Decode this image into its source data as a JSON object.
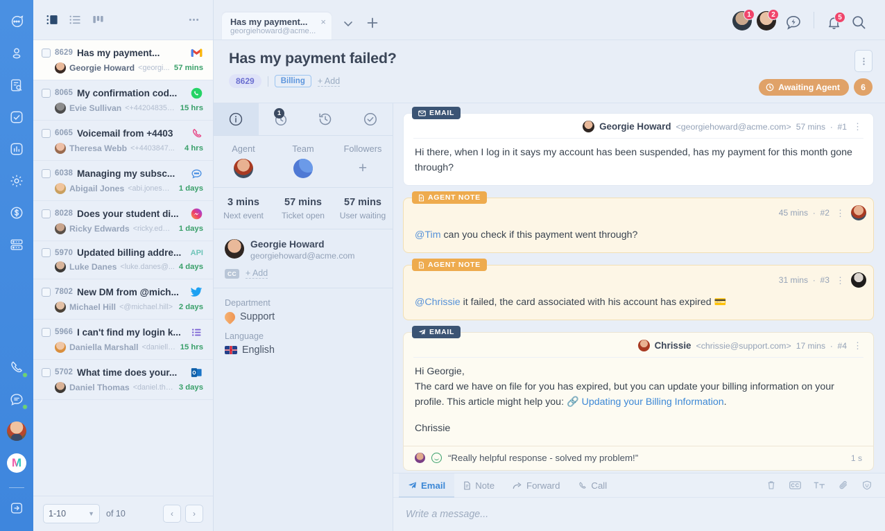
{
  "rail": {
    "items": [
      {
        "name": "chat",
        "icon": "chat-bubble-icon"
      },
      {
        "name": "contacts",
        "icon": "person-icon"
      },
      {
        "name": "search-docs",
        "icon": "document-search-icon"
      },
      {
        "name": "tasks",
        "icon": "check-square-icon"
      },
      {
        "name": "reports",
        "icon": "bar-chart-icon"
      },
      {
        "name": "settings",
        "icon": "gear-icon"
      },
      {
        "name": "billing",
        "icon": "dollar-circle-icon"
      },
      {
        "name": "servers",
        "icon": "server-icon"
      }
    ],
    "bottom": [
      {
        "name": "phone",
        "icon": "phone-icon",
        "status": "online"
      },
      {
        "name": "messages",
        "icon": "chat-lines-icon",
        "status": "online"
      },
      {
        "name": "profile",
        "icon": "avatar"
      },
      {
        "name": "brand",
        "icon": "logo",
        "logo_letter": "M"
      },
      {
        "name": "logout",
        "icon": "logout-arrow-icon"
      }
    ]
  },
  "list": {
    "toolbar": {
      "views": [
        "split-view-icon",
        "list-view-icon",
        "board-view-icon"
      ],
      "more": "more-dots-icon"
    },
    "tickets": [
      {
        "id": "8629",
        "subject": "Has my payment...",
        "author": "Georgie Howard",
        "email": "<georgi...",
        "time": "57 mins",
        "channel": "gmail",
        "selected": true
      },
      {
        "id": "8065",
        "subject": "My confirmation cod...",
        "author": "Evie Sullivan",
        "email": "<+442048356...",
        "time": "15 hrs",
        "channel": "whatsapp",
        "selected": false
      },
      {
        "id": "6065",
        "subject": "Voicemail from +4403",
        "author": "Theresa Webb",
        "email": "<+4403847...",
        "time": "4 hrs",
        "channel": "phone",
        "selected": false
      },
      {
        "id": "6038",
        "subject": "Managing my subsc...",
        "author": "Abigail Jones",
        "email": "<abi.jones@...",
        "time": "1 days",
        "channel": "chat",
        "selected": false
      },
      {
        "id": "8028",
        "subject": "Does your student di...",
        "author": "Ricky Edwards",
        "email": "<ricky.edwa...",
        "time": "1 days",
        "channel": "messenger",
        "selected": false
      },
      {
        "id": "5970",
        "subject": "Updated billing addre...",
        "author": "Luke Danes",
        "email": "<luke.danes@...",
        "time": "4 days",
        "channel": "api",
        "channel_label": "API",
        "selected": false
      },
      {
        "id": "7802",
        "subject": "New DM from @mich...",
        "author": "Michael Hill",
        "email": "<@michael.hill>",
        "time": "2 days",
        "channel": "twitter",
        "selected": false
      },
      {
        "id": "5966",
        "subject": "I can't find my login k...",
        "author": "Daniella Marshall",
        "email": "<daniella...",
        "time": "15 hrs",
        "channel": "form",
        "selected": false
      },
      {
        "id": "5702",
        "subject": "What time does your...",
        "author": "Daniel Thomas",
        "email": "<daniel.tho...",
        "time": "3 days",
        "channel": "outlook",
        "selected": false
      }
    ],
    "footer": {
      "range": "1-10",
      "of": "of 10",
      "prev": "‹",
      "next": "›"
    }
  },
  "topbar": {
    "tabs": [
      {
        "title": "Has my payment...",
        "subtitle": "georgiehoward@acme...",
        "close": "×"
      }
    ],
    "chevron": "chevron-down-icon",
    "plus": "plus-icon",
    "avatars": [
      {
        "badge": "1"
      },
      {
        "badge": "2"
      }
    ],
    "bolt_icon": "lightning-chat-icon",
    "bell_icon": "bell-icon",
    "bell_badge": "5",
    "search_icon": "search-icon"
  },
  "ticket": {
    "title": "Has my payment failed?",
    "id": "8629",
    "tag": "Billing",
    "add_tag": "+ Add",
    "status": "Awaiting Agent",
    "message_count": "6",
    "menu": "more-vertical-icon"
  },
  "info": {
    "tabs": [
      {
        "name": "details",
        "icon": "info-circle-icon",
        "active": true
      },
      {
        "name": "timer",
        "icon": "clock-icon",
        "badge": "1"
      },
      {
        "name": "history",
        "icon": "history-icon"
      },
      {
        "name": "resolved",
        "icon": "check-circle-icon"
      }
    ],
    "assign": [
      {
        "label": "Agent",
        "type": "avatar"
      },
      {
        "label": "Team",
        "type": "team"
      },
      {
        "label": "Followers",
        "type": "plus"
      }
    ],
    "stats": [
      {
        "value": "3 mins",
        "label": "Next event"
      },
      {
        "value": "57 mins",
        "label": "Ticket open"
      },
      {
        "value": "57 mins",
        "label": "User waiting"
      }
    ],
    "contact": {
      "name": "Georgie Howard",
      "email": "georgiehoward@acme.com",
      "cc_label": "CC",
      "cc_add": "+ Add"
    },
    "fields": [
      {
        "label": "Department",
        "value": "Support",
        "icon": "department-drop-icon"
      },
      {
        "label": "Language",
        "value": "English",
        "icon": "uk-flag-icon"
      }
    ]
  },
  "conversation": {
    "messages": [
      {
        "kind": "email",
        "direction": "in",
        "ribbon": "EMAIL",
        "ribbon_icon": "envelope-icon",
        "author": "Georgie Howard",
        "email": "<georgiehoward@acme.com>",
        "time": "57 mins",
        "num": "#1",
        "body": "Hi there, when I log in it says my account has been suspended, has my payment for this month gone through?"
      },
      {
        "kind": "note",
        "ribbon": "AGENT NOTE",
        "ribbon_icon": "note-icon",
        "time": "45 mins",
        "num": "#2",
        "mention": "@Tim",
        "body": " can you check if this payment went through?"
      },
      {
        "kind": "note",
        "ribbon": "AGENT NOTE",
        "ribbon_icon": "note-icon",
        "time": "31 mins",
        "num": "#3",
        "mention": "@Chrissie",
        "body": " it failed, the card associated with his account has expired 💳"
      },
      {
        "kind": "email",
        "direction": "out",
        "ribbon": "EMAIL",
        "ribbon_icon": "send-icon",
        "author": "Chrissie",
        "email": "<chrissie@support.com>",
        "time": "17 mins",
        "num": "#4",
        "line1": "Hi Georgie,",
        "line2": "The card we have on file for you has expired, but you can update your billing information on your profile. This article might help you: ",
        "link": "Updating your Billing Information",
        "line3": ".",
        "signoff": "Chrissie",
        "rating": "“Really helpful response - solved my problem!”",
        "rating_time": "1 s"
      }
    ]
  },
  "composer": {
    "tabs": [
      {
        "label": "Email",
        "icon": "send-icon",
        "active": true
      },
      {
        "label": "Note",
        "icon": "note-icon",
        "active": false
      },
      {
        "label": "Forward",
        "icon": "forward-arrow-icon",
        "active": false
      },
      {
        "label": "Call",
        "icon": "phone-icon",
        "active": false
      }
    ],
    "tools": [
      "trash-icon",
      "cc-icon",
      "text-format-icon",
      "paperclip-icon",
      "shield-icon"
    ],
    "placeholder": "Write a message..."
  },
  "colors": {
    "rail": "#4a90e2",
    "accent": "#3d88d6",
    "status": "#e0a268",
    "note": "#fdf6e6",
    "badge": "#f0456b",
    "time": "#3aa06a",
    "tag": "#5d96dd"
  }
}
